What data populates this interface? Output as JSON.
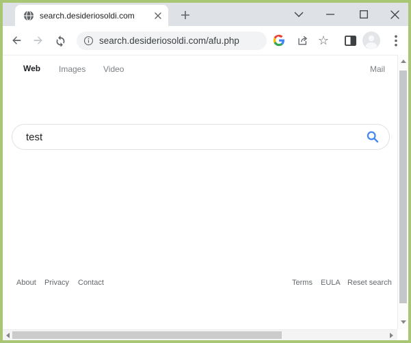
{
  "browser": {
    "tab_title": "search.desideriosoldi.com",
    "url": "search.desideriosoldi.com/afu.php"
  },
  "nav": {
    "web": "Web",
    "images": "Images",
    "video": "Video",
    "mail": "Mail"
  },
  "search": {
    "value": "test"
  },
  "footer": {
    "about": "About",
    "privacy": "Privacy",
    "contact": "Contact",
    "terms": "Terms",
    "eula": "EULA",
    "reset_search": "Reset search"
  },
  "icons": {
    "tab_favicon": "globe",
    "address_info": "info-circle",
    "google_logo": "google-g",
    "share": "share-arrow",
    "bookmark_star": "☆",
    "side_panel": "side-panel",
    "profile": "avatar-silhouette",
    "menu": "three-dots-vertical",
    "search_button": "magnifier"
  },
  "colors": {
    "window_border": "#a9c674",
    "tab_strip_bg": "#dee1e6",
    "omnibox_bg": "#f1f3f4",
    "icon_gray": "#5f6368",
    "url_text": "#3c4043",
    "search_icon_blue": "#4285f4",
    "scrollbar_thumb": "#c4c7ca"
  }
}
